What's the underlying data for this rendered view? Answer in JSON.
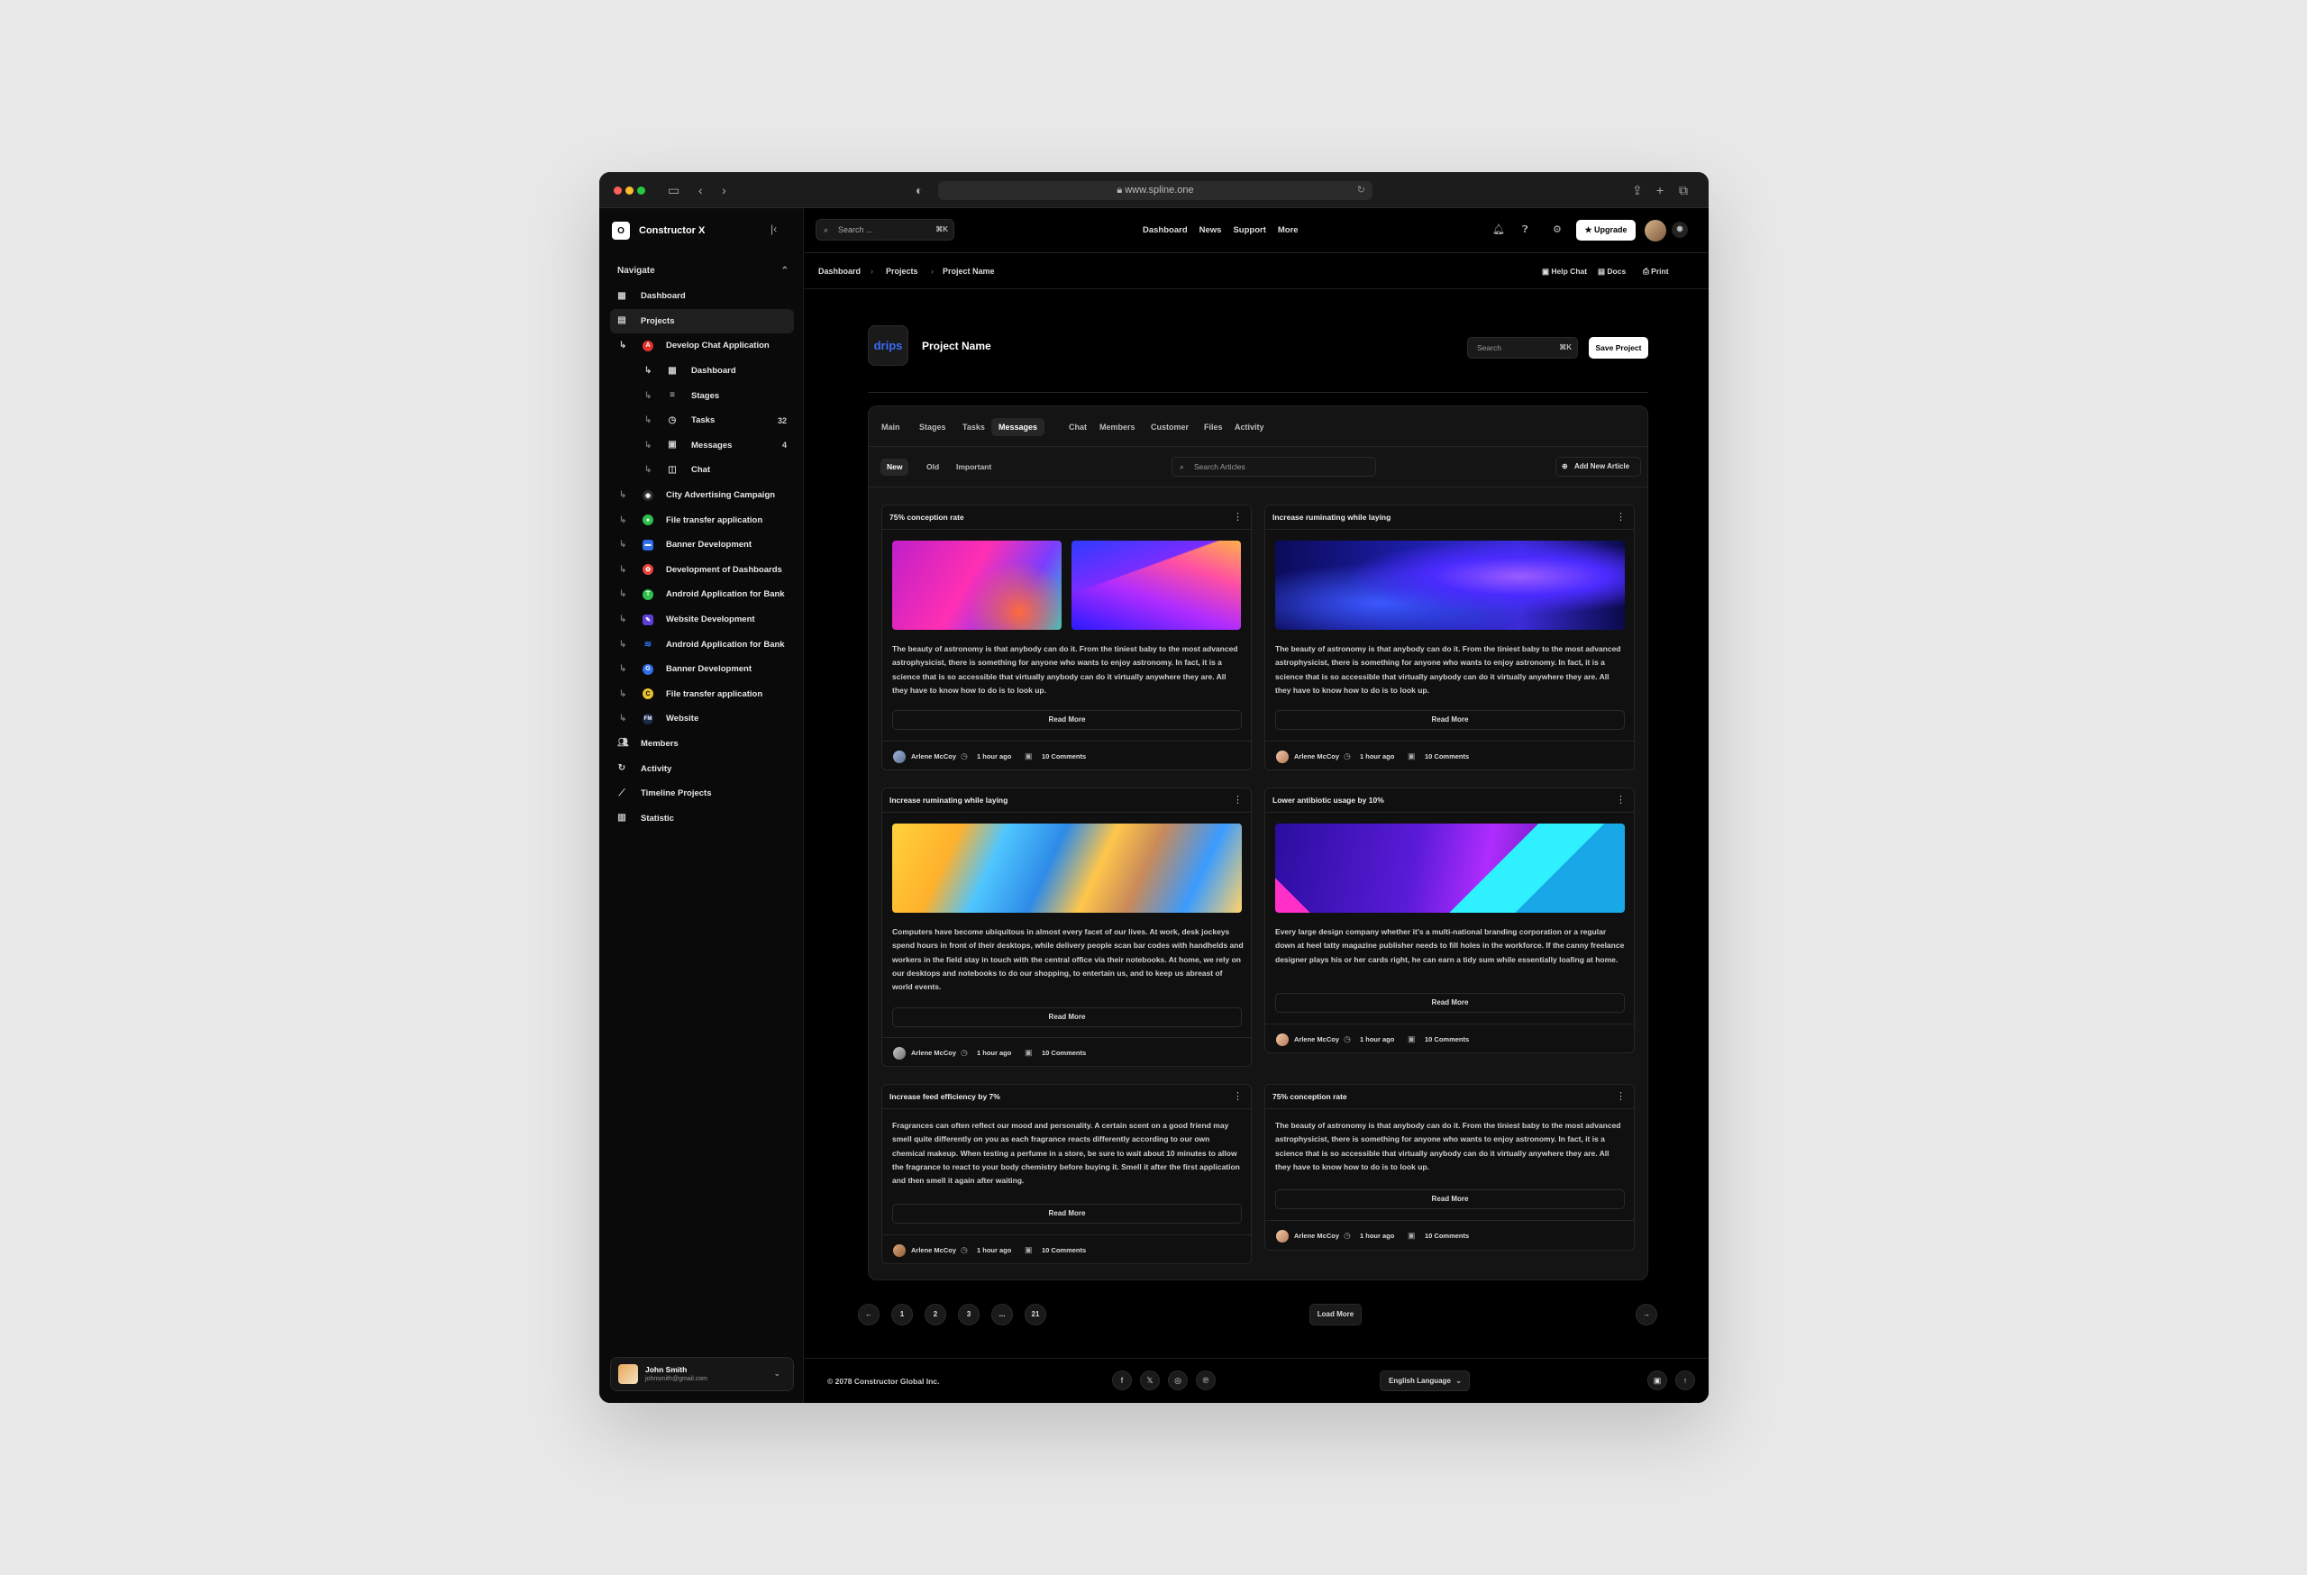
{
  "browser": {
    "url": "www.spline.one"
  },
  "sidebar": {
    "brand": "Constructor X",
    "brand_logo": "O",
    "section": "Navigate",
    "items": [
      {
        "label": "Dashboard"
      },
      {
        "label": "Projects"
      },
      {
        "label": "Develop Chat Application"
      },
      {
        "label": "Dashboard"
      },
      {
        "label": "Stages"
      },
      {
        "label": "Tasks",
        "count": "32"
      },
      {
        "label": "Messages",
        "count": "4"
      },
      {
        "label": "Chat"
      },
      {
        "label": "City Advertising Campaign"
      },
      {
        "label": "File transfer application"
      },
      {
        "label": "Banner Development"
      },
      {
        "label": "Development of Dashboards"
      },
      {
        "label": "Android Application for Bank"
      },
      {
        "label": "Website Development"
      },
      {
        "label": "Android Application for Bank"
      },
      {
        "label": "Banner Development"
      },
      {
        "label": "File transfer application"
      },
      {
        "label": "Website"
      },
      {
        "label": "Members"
      },
      {
        "label": "Activity"
      },
      {
        "label": "Timeline Projects"
      },
      {
        "label": "Statistic"
      }
    ],
    "user": {
      "name": "John Smith",
      "email": "johnsmith@gmail.com"
    }
  },
  "topbar": {
    "search_placeholder": "Search ...",
    "shortcut": "⌘K",
    "nav": [
      "Dashboard",
      "News",
      "Support",
      "More"
    ],
    "upgrade": "Upgrade"
  },
  "breadcrumb": {
    "items": [
      "Dashboard",
      "Projects",
      "Project Name"
    ],
    "actions": [
      "Help Chat",
      "Docs",
      "Print"
    ]
  },
  "project": {
    "logo": "drips",
    "title": "Project Name",
    "search_placeholder": "Search",
    "shortcut": "⌘K",
    "save": "Save Project"
  },
  "tabs": [
    "Main",
    "Stages",
    "Tasks",
    "Messages",
    "Chat",
    "Members",
    "Customer",
    "Files",
    "Activity"
  ],
  "filters": [
    "New",
    "Old",
    "Important"
  ],
  "article_search_placeholder": "Search Articles",
  "add_article": "Add New Article",
  "cards": [
    {
      "title": "75% conception rate",
      "text": "The beauty of astronomy is that anybody can do it. From the tiniest baby to the most advanced astrophysicist, there is something for anyone who wants to enjoy astronomy. In fact, it is a science that is so accessible that virtually anybody can do it virtually anywhere they are. All they have to know how to do is to look up.",
      "read": "Read More",
      "author": "Arlene McCoy",
      "time": "1 hour ago",
      "comments": "10 Comments"
    },
    {
      "title": "Increase ruminating while laying",
      "text": "The beauty of astronomy is that anybody can do it. From the tiniest baby to the most advanced astrophysicist, there is something for anyone who wants to enjoy astronomy. In fact, it is a science that is so accessible that virtually anybody can do it virtually anywhere they are. All they have to know how to do is to look up.",
      "read": "Read More",
      "author": "Arlene McCoy",
      "time": "1 hour ago",
      "comments": "10 Comments"
    },
    {
      "title": "Increase ruminating while laying",
      "text": "Computers have become ubiquitous in almost every facet of our lives. At work, desk jockeys spend hours in front of their desktops, while delivery people scan bar codes with handhelds and workers in the field stay in touch with the central office via their notebooks. At home, we rely on our desktops and notebooks to do our shopping, to entertain us, and to keep us abreast of world events.",
      "read": "Read More",
      "author": "Arlene McCoy",
      "time": "1 hour ago",
      "comments": "10 Comments"
    },
    {
      "title": "Lower antibiotic usage by 10%",
      "text": "Every large design company whether it’s a multi-national branding corporation or a regular down at heel tatty magazine publisher needs to fill holes in the workforce. If the canny freelance designer plays his or her cards right, he can earn a tidy sum while essentially loafing at home.",
      "read": "Read More",
      "author": "Arlene McCoy",
      "time": "1 hour ago",
      "comments": "10 Comments"
    },
    {
      "title": "Increase feed efficiency by 7%",
      "text": "Fragrances can often reflect our mood and personality. A certain scent on a good friend may smell quite differently on you as each fragrance reacts differently according to our own chemical makeup. When testing a perfume in a store, be sure to wait about 10 minutes to allow the fragrance to react to your body chemistry before buying it. Smell it after the first application and then smell it again after waiting.",
      "read": "Read More",
      "author": "Arlene McCoy",
      "time": "1 hour ago",
      "comments": "10 Comments"
    },
    {
      "title": "75% conception rate",
      "text": "The beauty of astronomy is that anybody can do it. From the tiniest baby to the most advanced astrophysicist, there is something for anyone who wants to enjoy astronomy. In fact, it is a science that is so accessible that virtually anybody can do it virtually anywhere they are. All they have to know how to do is to look up.",
      "read": "Read More",
      "author": "Arlene McCoy",
      "time": "1 hour ago",
      "comments": "10 Comments"
    }
  ],
  "pagination": {
    "pages": [
      "1",
      "2",
      "3",
      "...",
      "21"
    ],
    "load_more": "Load More"
  },
  "footer": {
    "copyright": "© 2078 Constructor Global Inc.",
    "language": "English Language"
  }
}
